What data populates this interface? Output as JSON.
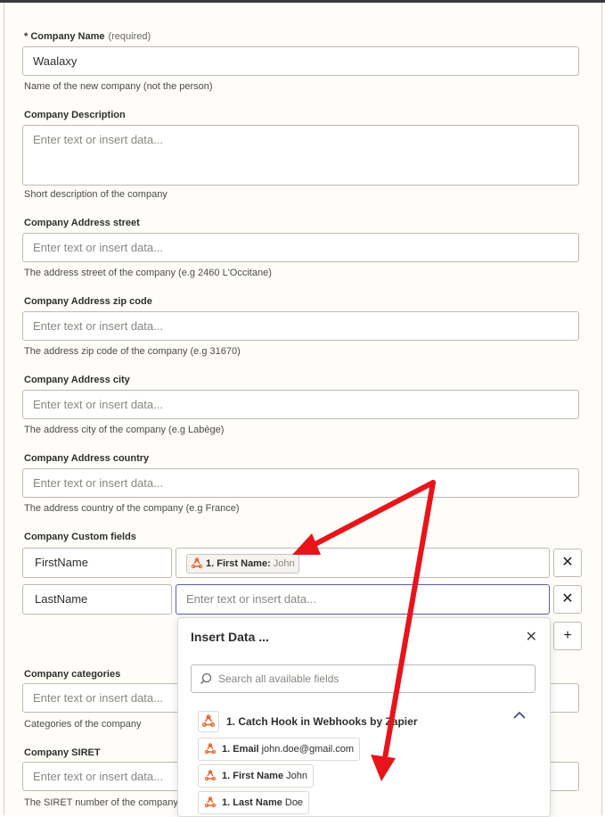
{
  "form": {
    "company_name": {
      "label": "* Company Name",
      "required": "(required)",
      "value": "Waalaxy",
      "help": "Name of the new company (not the person)"
    },
    "company_description": {
      "label": "Company Description",
      "placeholder": "Enter text or insert data...",
      "help": "Short description of the company"
    },
    "address_street": {
      "label": "Company Address street",
      "placeholder": "Enter text or insert data...",
      "help": "The address street of the company (e.g 2460 L'Occitane)"
    },
    "address_zip": {
      "label": "Company Address zip code",
      "placeholder": "Enter text or insert data...",
      "help": "The address zip code of the company (e.g 31670)"
    },
    "address_city": {
      "label": "Company Address city",
      "placeholder": "Enter text or insert data...",
      "help": "The address city of the company (e.g Labège)"
    },
    "address_country": {
      "label": "Company Address country",
      "placeholder": "Enter text or insert data...",
      "help": "The address country of the company (e.g France)"
    },
    "custom_fields": {
      "label": "Company Custom fields",
      "rows": [
        {
          "key": "FirstName",
          "pill_label": "1. First Name:",
          "pill_value": "John"
        },
        {
          "key": "LastName",
          "placeholder": "Enter text or insert data..."
        }
      ],
      "remove_glyph": "✕",
      "add_glyph": "+"
    },
    "categories": {
      "label": "Company categories",
      "placeholder": "Enter text or insert data...",
      "help": "Categories of the company"
    },
    "siret": {
      "label": "Company SIRET",
      "placeholder": "Enter text or insert data...",
      "help": "The SIRET number of the company"
    }
  },
  "insert_panel": {
    "title": "Insert Data ...",
    "close_glyph": "✕",
    "search_placeholder": "Search all available fields",
    "group_title": "1. Catch Hook in Webhooks by Zapier",
    "items": [
      {
        "label": "1. Email",
        "value": "john.doe@gmail.com"
      },
      {
        "label": "1. First Name",
        "value": "John"
      },
      {
        "label": "1. Last Name",
        "value": "Doe"
      }
    ]
  },
  "colors": {
    "arrow": "#e8141b",
    "zap_orange": "#e8652d",
    "focus": "#5b5ea6"
  },
  "icons": [
    "webhook-icon",
    "search-icon",
    "chevron-up-icon",
    "close-icon",
    "plus-icon"
  ]
}
